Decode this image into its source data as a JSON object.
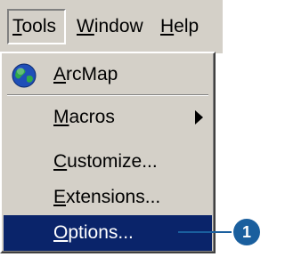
{
  "menubar": {
    "tools": {
      "label": "Tools",
      "mnemonic": "T",
      "rest": "ools"
    },
    "window": {
      "label": "Window",
      "mnemonic": "W",
      "rest": "indow"
    },
    "help": {
      "label": "Help",
      "mnemonic": "H",
      "rest": "elp"
    }
  },
  "menu": {
    "items": [
      {
        "label": "ArcMap",
        "mnemonic": "A",
        "rest": "rcMap",
        "icon": "arcmap-globe-icon"
      },
      {
        "label": "Macros",
        "mnemonic": "M",
        "rest": "acros",
        "submenu_arrow": true
      },
      {
        "label": "Customize...",
        "mnemonic": "C",
        "rest": "ustomize..."
      },
      {
        "label": "Extensions...",
        "mnemonic": "E",
        "rest": "xtensions..."
      },
      {
        "label": "Options...",
        "mnemonic": "O",
        "rest": "ptions...",
        "selected": true
      }
    ]
  },
  "callout": {
    "number": "1",
    "color": "#1a5f9e"
  },
  "colors": {
    "menu_bg": "#d4d0c8",
    "highlight": "#0a246a",
    "highlight_text": "#ffffff"
  }
}
